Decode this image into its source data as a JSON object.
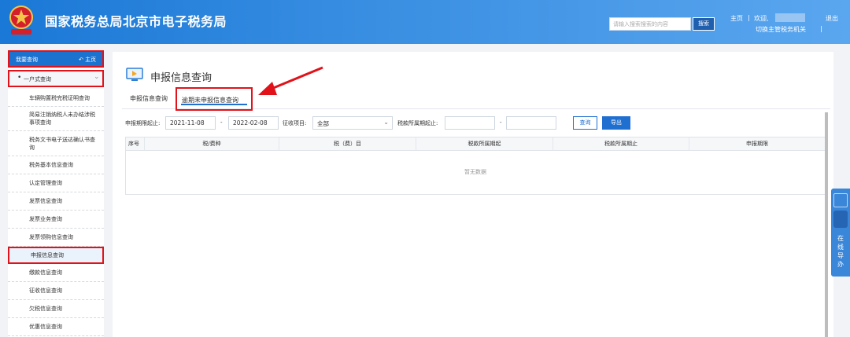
{
  "header": {
    "title": "国家税务总局北京市电子税务局",
    "search_placeholder": "请输入搜索搜索的内容",
    "search_button": "搜索",
    "home_link": "主页",
    "separator": "|",
    "welcome": "欢迎,",
    "logout": "退出",
    "switch_org": "切换主管税务机关",
    "switch_sep": "|"
  },
  "sidebar": {
    "head_label": "我要查询",
    "home_label": "主页",
    "group_label": "一户式查询",
    "items": [
      {
        "label": "车辆购置税完税证明查询"
      },
      {
        "label": "简易注销纳税人未办结涉税事项查询"
      },
      {
        "label": "税务文书电子送达确认书查询"
      },
      {
        "label": "税务基本信息查询"
      },
      {
        "label": "认定管理查询"
      },
      {
        "label": "发票信息查询"
      },
      {
        "label": "发票业务查询"
      },
      {
        "label": "发票领购信息查询"
      },
      {
        "label": "申报信息查询"
      },
      {
        "label": "缴款信息查询"
      },
      {
        "label": "征收信息查询"
      },
      {
        "label": "欠税信息查询"
      },
      {
        "label": "优惠信息查询"
      }
    ],
    "active_index": 8
  },
  "main": {
    "title": "申报信息查询",
    "tabs": [
      {
        "label": "申报信息查询"
      },
      {
        "label": "逾期未申报信息查询"
      }
    ],
    "filters": {
      "deadline_label": "申报期限起止:",
      "date_from": "2021-11-08",
      "dash1": "-",
      "date_to": "2022-02-08",
      "item_label": "征收项目:",
      "item_value": "全部",
      "period_label": "税款所属期起止:",
      "period_from": "",
      "dash2": "-",
      "period_to": "",
      "query_button": "查询",
      "export_button": "导出"
    },
    "table": {
      "columns": [
        "序号",
        "税/费种",
        "税（费）目",
        "税款所属期起",
        "税款所属期止",
        "申报期限"
      ],
      "empty_text": "暂无数据"
    }
  },
  "help_widget": {
    "text": "在线导办"
  },
  "colors": {
    "header_blue": "#1a78d6",
    "accent_blue": "#1f6fd1",
    "highlight_red": "#e1121a"
  }
}
